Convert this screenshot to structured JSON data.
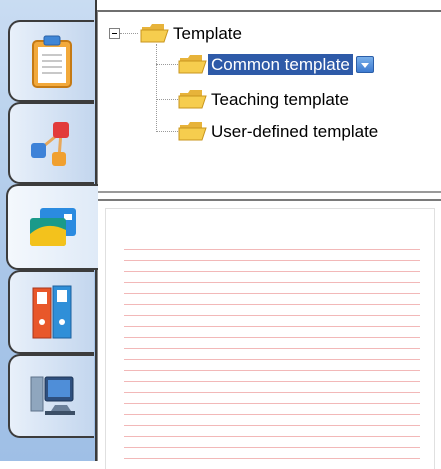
{
  "tree": {
    "root": {
      "label": "Template",
      "icon": "folder-open-icon",
      "expanded": true
    },
    "children": [
      {
        "label": "Common template",
        "icon": "folder-open-icon",
        "selected": true,
        "has_dropdown": true
      },
      {
        "label": "Teaching template",
        "icon": "folder-open-icon",
        "selected": false
      },
      {
        "label": "User-defined template",
        "icon": "folder-open-icon",
        "selected": false
      }
    ]
  },
  "sidebar": {
    "tabs": [
      {
        "name": "clipboard-icon",
        "active": false
      },
      {
        "name": "network-diagram-icon",
        "active": false
      },
      {
        "name": "template-cards-icon",
        "active": true
      },
      {
        "name": "binders-icon",
        "active": false
      },
      {
        "name": "computer-icon",
        "active": false
      }
    ]
  },
  "preview": {
    "style": "ruled-paper",
    "line_color": "#f2b8b8"
  },
  "colors": {
    "selection": "#2e5aa8",
    "rail": "#a9c6e8"
  }
}
